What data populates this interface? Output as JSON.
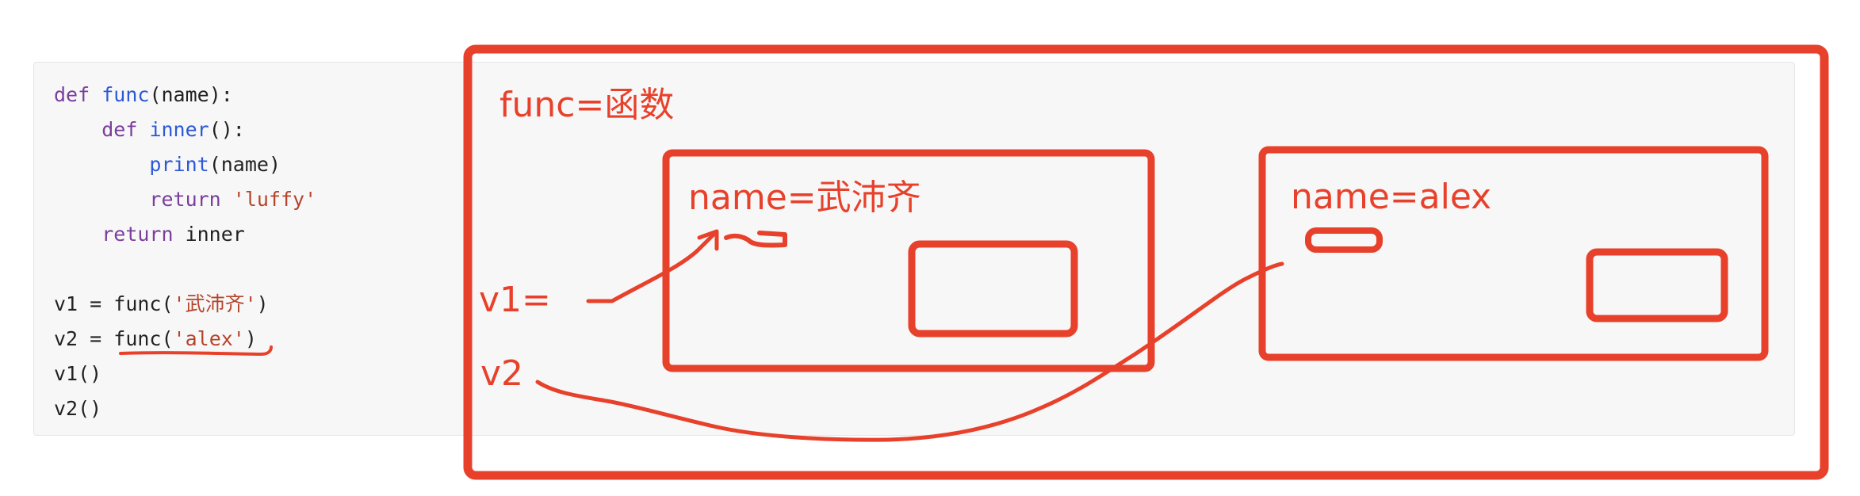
{
  "code": {
    "lines": [
      {
        "tokens": [
          {
            "t": "def",
            "c": "kw"
          },
          {
            "t": " ",
            "c": "plain"
          },
          {
            "t": "func",
            "c": "fn"
          },
          {
            "t": "(name):",
            "c": "plain"
          }
        ]
      },
      {
        "tokens": [
          {
            "t": "    ",
            "c": "plain"
          },
          {
            "t": "def",
            "c": "kw"
          },
          {
            "t": " ",
            "c": "plain"
          },
          {
            "t": "inner",
            "c": "fn"
          },
          {
            "t": "():",
            "c": "plain"
          }
        ]
      },
      {
        "tokens": [
          {
            "t": "        ",
            "c": "plain"
          },
          {
            "t": "print",
            "c": "fn"
          },
          {
            "t": "(name)",
            "c": "plain"
          }
        ]
      },
      {
        "tokens": [
          {
            "t": "        ",
            "c": "plain"
          },
          {
            "t": "return",
            "c": "kw"
          },
          {
            "t": " ",
            "c": "plain"
          },
          {
            "t": "'luffy'",
            "c": "str"
          }
        ]
      },
      {
        "tokens": [
          {
            "t": "    ",
            "c": "plain"
          },
          {
            "t": "return",
            "c": "kw"
          },
          {
            "t": " inner",
            "c": "plain"
          }
        ]
      },
      {
        "tokens": []
      },
      {
        "tokens": [
          {
            "t": "v1 = ",
            "c": "plain"
          },
          {
            "t": "func",
            "c": "plain"
          },
          {
            "t": "(",
            "c": "plain"
          },
          {
            "t": "'武沛齐'",
            "c": "str"
          },
          {
            "t": ")",
            "c": "plain"
          }
        ]
      },
      {
        "tokens": [
          {
            "t": "v2 = ",
            "c": "plain"
          },
          {
            "t": "func",
            "c": "plain"
          },
          {
            "t": "(",
            "c": "plain"
          },
          {
            "t": "'alex'",
            "c": "str"
          },
          {
            "t": ")",
            "c": "plain"
          }
        ]
      },
      {
        "tokens": [
          {
            "t": "v1()",
            "c": "plain"
          }
        ]
      },
      {
        "tokens": [
          {
            "t": "v2()",
            "c": "plain"
          }
        ]
      }
    ]
  },
  "annotations": {
    "func_label": "func=函数",
    "scope1_label": "name=武沛齐",
    "scope2_label": "name=alex",
    "v1_label": "v1=",
    "v2_label": "v2"
  },
  "colors": {
    "annotation": "#e8412b",
    "keyword": "#7a3e9d",
    "function": "#2c59d6",
    "string": "#b5442b",
    "code_background": "#f7f7f7"
  }
}
